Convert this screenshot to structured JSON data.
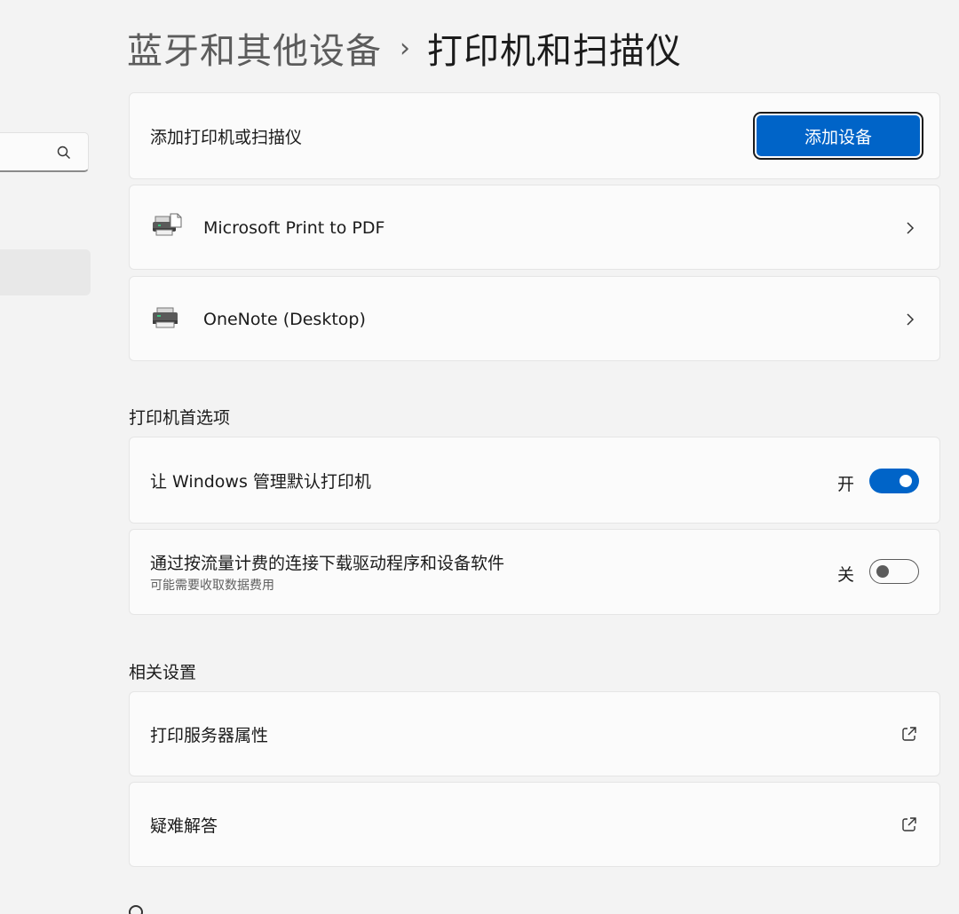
{
  "breadcrumb": {
    "parent": "蓝牙和其他设备",
    "separator": "›",
    "current": "打印机和扫描仪"
  },
  "add_printer": {
    "label": "添加打印机或扫描仪",
    "button": "添加设备"
  },
  "printers": [
    {
      "name": "Microsoft Print to PDF",
      "icon": "pdf-printer-icon"
    },
    {
      "name": "OneNote (Desktop)",
      "icon": "printer-icon"
    }
  ],
  "preferences": {
    "title": "打印机首选项",
    "items": [
      {
        "label": "让 Windows 管理默认打印机",
        "sub": "",
        "state_label": "开",
        "on": true
      },
      {
        "label": "通过按流量计费的连接下载驱动程序和设备软件",
        "sub": "可能需要收取数据费用",
        "state_label": "关",
        "on": false
      }
    ]
  },
  "related": {
    "title": "相关设置",
    "items": [
      {
        "label": "打印服务器属性",
        "icon": "open-external-icon"
      },
      {
        "label": "疑难解答",
        "icon": "open-external-icon"
      }
    ]
  },
  "colors": {
    "accent": "#0064c8",
    "background": "#f3f3f3",
    "card": "#fbfbfb"
  }
}
